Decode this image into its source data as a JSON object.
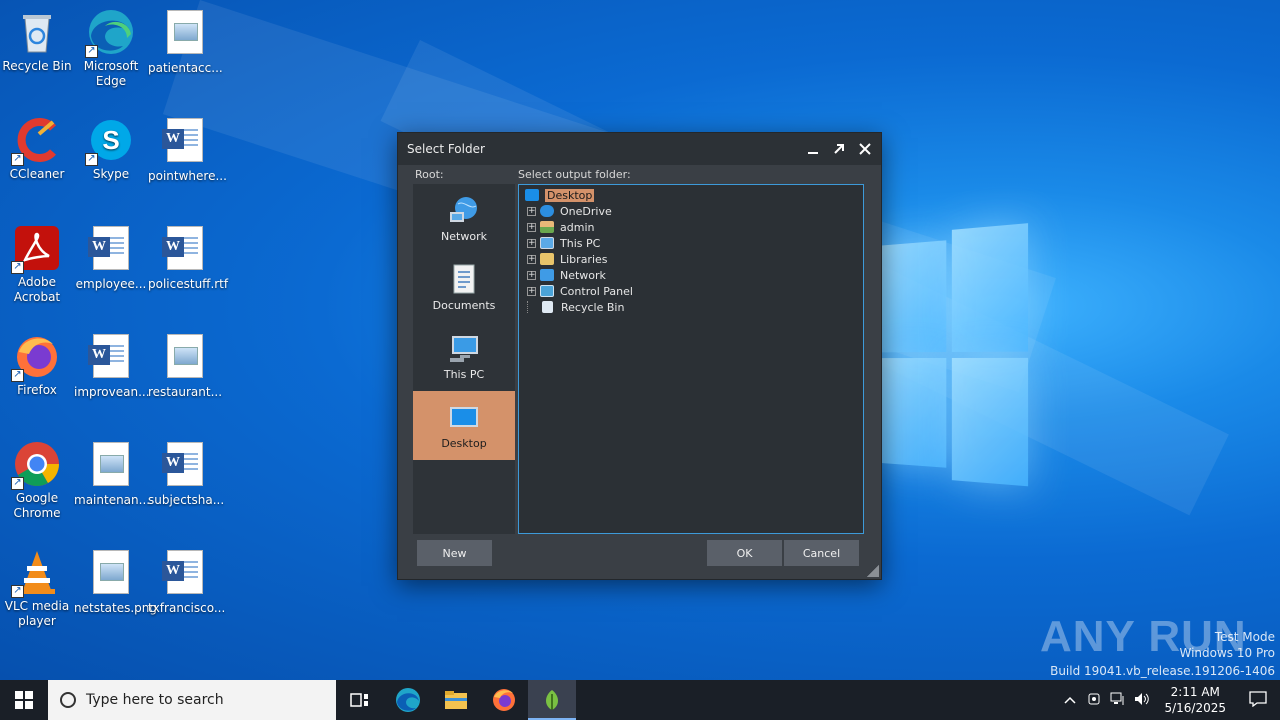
{
  "desktop": {
    "icons": [
      {
        "label": "Recycle Bin",
        "icon": "recycle-bin-icon"
      },
      {
        "label": "Microsoft Edge",
        "icon": "edge-icon"
      },
      {
        "label": "patientacc...",
        "icon": "image-file-icon"
      },
      {
        "label": "CCleaner",
        "icon": "ccleaner-icon"
      },
      {
        "label": "Skype",
        "icon": "skype-icon"
      },
      {
        "label": "pointwhere...",
        "icon": "word-file-icon"
      },
      {
        "label": "Adobe Acrobat",
        "icon": "acrobat-icon"
      },
      {
        "label": "employee...",
        "icon": "word-file-icon"
      },
      {
        "label": "policestuff.rtf",
        "icon": "word-file-icon"
      },
      {
        "label": "Firefox",
        "icon": "firefox-icon"
      },
      {
        "label": "improvean...",
        "icon": "word-file-icon"
      },
      {
        "label": "restaurant...",
        "icon": "image-file-icon"
      },
      {
        "label": "Google Chrome",
        "icon": "chrome-icon"
      },
      {
        "label": "maintenan...",
        "icon": "image-file-icon"
      },
      {
        "label": "subjectsha...",
        "icon": "word-file-icon"
      },
      {
        "label": "VLC media player",
        "icon": "vlc-icon"
      },
      {
        "label": "netstates.png",
        "icon": "image-file-icon"
      },
      {
        "label": "txfrancisco...",
        "icon": "word-file-icon"
      }
    ]
  },
  "dialog": {
    "title": "Select Folder",
    "root_label": "Root:",
    "output_label": "Select output folder:",
    "roots": [
      {
        "label": "Network",
        "icon": "network-icon",
        "active": false
      },
      {
        "label": "Documents",
        "icon": "documents-icon",
        "active": false
      },
      {
        "label": "This PC",
        "icon": "this-pc-icon",
        "active": false
      },
      {
        "label": "Desktop",
        "icon": "desktop-icon",
        "active": true
      }
    ],
    "tree": {
      "root": "Desktop",
      "children": [
        {
          "label": "OneDrive",
          "icon": "onedrive-icon",
          "expandable": true
        },
        {
          "label": "admin",
          "icon": "user-folder-icon",
          "expandable": true
        },
        {
          "label": "This PC",
          "icon": "this-pc-icon",
          "expandable": true
        },
        {
          "label": "Libraries",
          "icon": "libraries-icon",
          "expandable": true
        },
        {
          "label": "Network",
          "icon": "network-icon",
          "expandable": true
        },
        {
          "label": "Control Panel",
          "icon": "control-panel-icon",
          "expandable": true
        },
        {
          "label": "Recycle Bin",
          "icon": "recycle-bin-icon",
          "expandable": false
        }
      ]
    },
    "buttons": {
      "new": "New",
      "ok": "OK",
      "cancel": "Cancel"
    }
  },
  "watermark": {
    "brand": "ANY RUN",
    "mode": "Test Mode",
    "edition": "Windows 10 Pro",
    "build": "Build 19041.vb_release.191206-1406"
  },
  "taskbar": {
    "search_placeholder": "Type here to search",
    "time": "2:11 AM",
    "date": "5/16/2025"
  },
  "colors": {
    "dialog_bg": "#3a3f45",
    "selection": "#d4926a",
    "tree_border": "#3d9ad9",
    "taskbar": "#1a1f27"
  }
}
